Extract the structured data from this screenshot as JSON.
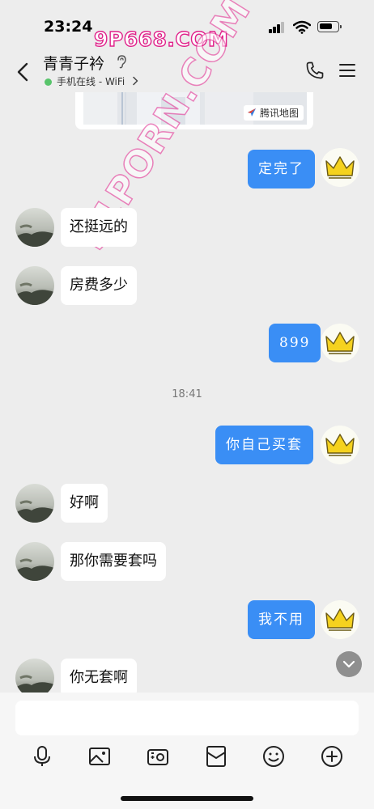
{
  "status_bar": {
    "time": "23:24"
  },
  "watermarks": {
    "top": "9P668.COM",
    "diagonal": "91PORN.COM"
  },
  "header": {
    "title": "青青子衿",
    "presence": "手机在线 - WiFi"
  },
  "map_card": {
    "provider": "腾讯地图"
  },
  "messages": [
    {
      "side": "out",
      "text": "定完了"
    },
    {
      "side": "in",
      "text": "还挺远的"
    },
    {
      "side": "in",
      "text": "房费多少"
    },
    {
      "side": "out",
      "text": "899"
    },
    {
      "side": "out",
      "text": "你自己买套"
    },
    {
      "side": "in",
      "text": "好啊"
    },
    {
      "side": "in",
      "text": "那你需要套吗"
    },
    {
      "side": "out",
      "text": "我不用"
    },
    {
      "side": "in",
      "text": "你无套啊"
    }
  ],
  "timestamp": "18:41",
  "input": {
    "placeholder": ""
  },
  "toolbar": [
    "microphone-icon",
    "image-icon",
    "camera-icon",
    "red-packet-icon",
    "emoji-icon",
    "plus-icon"
  ],
  "colors": {
    "bubble_out": "#3a8ef5",
    "bubble_in": "#ffffff",
    "background": "#ededed",
    "online": "#58c46b"
  }
}
